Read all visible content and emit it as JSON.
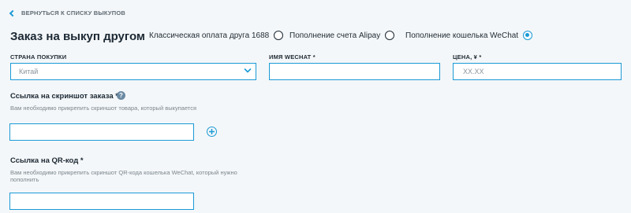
{
  "back_link": {
    "label": "ВЕРНУТЬСЯ К СПИСКУ ВЫКУПОВ",
    "icon": "chevron-left-icon"
  },
  "page_title": "Заказ на выкуп другом",
  "payment_options": [
    {
      "label": "Классическая оплата друга 1688",
      "checked": false
    },
    {
      "label": "Пополнение счета Alipay",
      "checked": false
    },
    {
      "label": "Пополнение кошелька WeChat",
      "checked": true
    }
  ],
  "fields": {
    "country": {
      "label": "СТРАНА ПОКУПКИ",
      "value": "Китай"
    },
    "wechat_name": {
      "label": "ИМЯ WECHAT *",
      "value": ""
    },
    "price": {
      "label": "ЦЕНА, ¥ *",
      "placeholder": "XX.XX"
    }
  },
  "screenshot_link": {
    "title": "Ссылка на скриншот заказа *",
    "hint": "Вам необходимо прикрепить скриншот товара, который выкупается",
    "value": ""
  },
  "qr_link": {
    "title": "Ссылка на QR-код *",
    "hint_line1": "Вам необходимо прикрепить скриншот QR-кода кошелька WeChat, который нужно",
    "hint_line2": "пополнить",
    "value": ""
  },
  "colors": {
    "accent": "#1a9ad6",
    "background": "#f4f7f9",
    "text": "#1b2833",
    "hint": "#7b868e"
  }
}
